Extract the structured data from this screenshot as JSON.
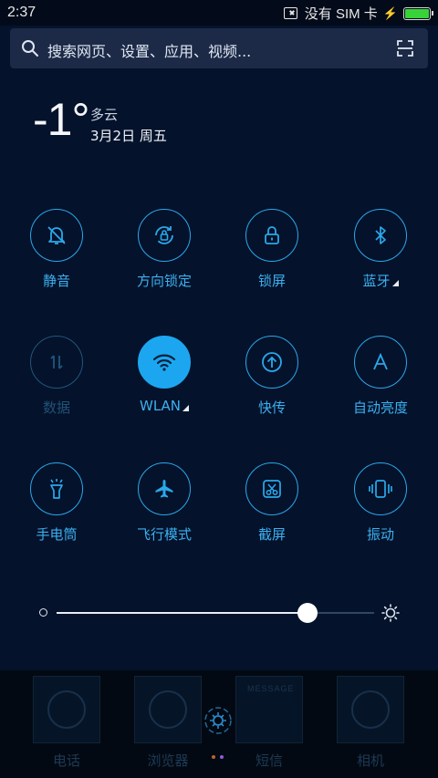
{
  "status_bar": {
    "time": "2:37",
    "carrier": "没有 SIM 卡",
    "battery_level": 1.0,
    "battery_color": "#37d437"
  },
  "search": {
    "placeholder": "搜索网页、设置、应用、视频...",
    "icon": "search-icon",
    "scan_icon": "scan-icon"
  },
  "weather": {
    "temperature": "-1°",
    "condition": "多云",
    "date": "3月2日 周五"
  },
  "toggles": [
    {
      "label": "静音",
      "icon": "mute-bell-icon",
      "state": "off"
    },
    {
      "label": "方向锁定",
      "icon": "rotation-lock-icon",
      "state": "off"
    },
    {
      "label": "锁屏",
      "icon": "lock-icon",
      "state": "off"
    },
    {
      "label": "蓝牙",
      "icon": "bluetooth-icon",
      "state": "off",
      "has_menu": true
    },
    {
      "label": "数据",
      "icon": "mobile-data-icon",
      "state": "disabled"
    },
    {
      "label": "WLAN",
      "icon": "wifi-icon",
      "state": "on",
      "has_menu": true
    },
    {
      "label": "快传",
      "icon": "quick-transfer-icon",
      "state": "off"
    },
    {
      "label": "自动亮度",
      "icon": "auto-brightness-icon",
      "state": "off"
    },
    {
      "label": "手电筒",
      "icon": "flashlight-icon",
      "state": "off"
    },
    {
      "label": "飞行模式",
      "icon": "airplane-icon",
      "state": "off"
    },
    {
      "label": "截屏",
      "icon": "screenshot-icon",
      "state": "off"
    },
    {
      "label": "振动",
      "icon": "vibrate-icon",
      "state": "off"
    }
  ],
  "brightness": {
    "level": 0.79
  },
  "dock": {
    "apps": [
      {
        "label": "电话",
        "icon": "phone-icon"
      },
      {
        "label": "浏览器",
        "icon": "browser-icon"
      },
      {
        "label": "短信",
        "icon": "message-icon",
        "tag": "MESSAGE"
      },
      {
        "label": "相机",
        "icon": "camera-icon"
      }
    ],
    "page_dots": [
      "#c0602a",
      "#8a5ed8"
    ]
  },
  "colors": {
    "accent": "#2aa8ea",
    "active": "#1da6f0",
    "background": "#04122b"
  }
}
